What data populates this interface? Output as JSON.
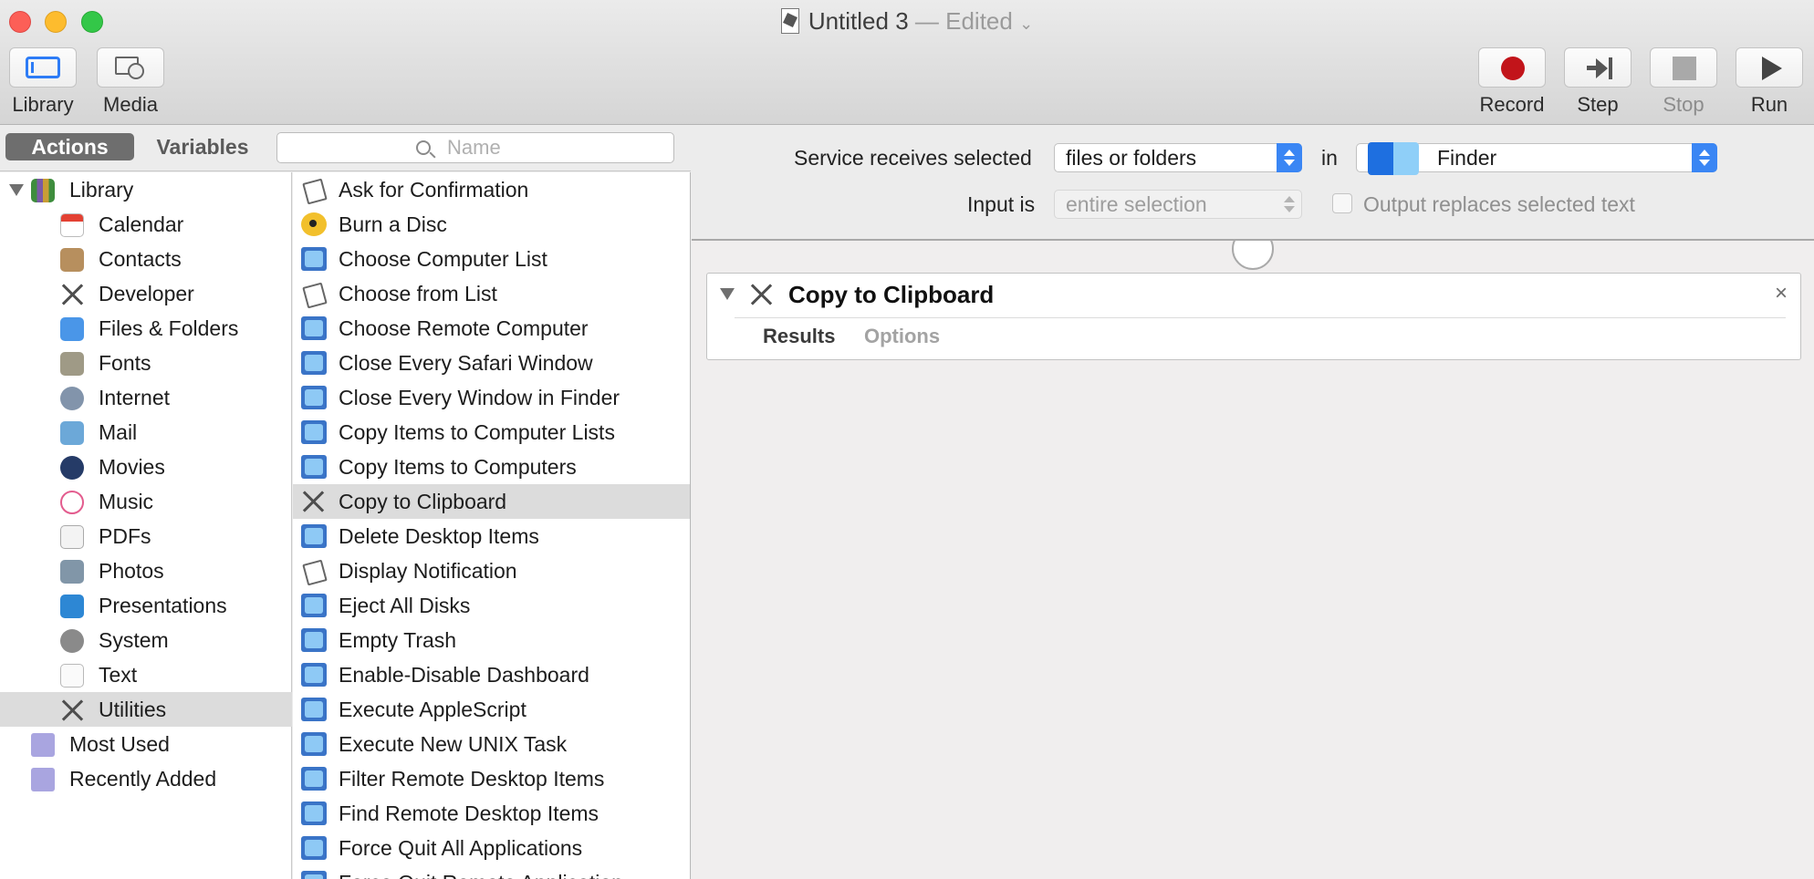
{
  "window": {
    "title": "Untitled 3",
    "title_status": "— Edited"
  },
  "toolbar": {
    "library_label": "Library",
    "media_label": "Media",
    "record_label": "Record",
    "step_label": "Step",
    "stop_label": "Stop",
    "run_label": "Run",
    "record_color": "#c2141a"
  },
  "tabs": {
    "actions": "Actions",
    "variables": "Variables"
  },
  "search": {
    "placeholder": "Name",
    "value": ""
  },
  "library": {
    "root": "Library",
    "items": [
      {
        "label": "Calendar",
        "icon": "calendar-icon"
      },
      {
        "label": "Contacts",
        "icon": "contacts-icon"
      },
      {
        "label": "Developer",
        "icon": "developer-icon"
      },
      {
        "label": "Files & Folders",
        "icon": "finder-icon"
      },
      {
        "label": "Fonts",
        "icon": "fonts-icon"
      },
      {
        "label": "Internet",
        "icon": "internet-icon"
      },
      {
        "label": "Mail",
        "icon": "mail-icon"
      },
      {
        "label": "Movies",
        "icon": "movies-icon"
      },
      {
        "label": "Music",
        "icon": "music-icon"
      },
      {
        "label": "PDFs",
        "icon": "pdf-icon"
      },
      {
        "label": "Photos",
        "icon": "photos-icon"
      },
      {
        "label": "Presentations",
        "icon": "presentations-icon"
      },
      {
        "label": "System",
        "icon": "system-icon"
      },
      {
        "label": "Text",
        "icon": "text-icon"
      },
      {
        "label": "Utilities",
        "icon": "utilities-icon",
        "selected": true
      }
    ],
    "smart_groups": [
      {
        "label": "Most Used",
        "icon": "smart-folder-icon"
      },
      {
        "label": "Recently Added",
        "icon": "smart-folder-icon"
      }
    ]
  },
  "actions": [
    {
      "label": "Ask for Confirmation",
      "icon": "applescript-icon"
    },
    {
      "label": "Burn a Disc",
      "icon": "burn-disc-icon"
    },
    {
      "label": "Choose Computer List",
      "icon": "remote-desktop-icon"
    },
    {
      "label": "Choose from List",
      "icon": "applescript-icon"
    },
    {
      "label": "Choose Remote Computer",
      "icon": "remote-desktop-icon"
    },
    {
      "label": "Close Every Safari Window",
      "icon": "remote-desktop-icon"
    },
    {
      "label": "Close Every Window in Finder",
      "icon": "remote-desktop-icon"
    },
    {
      "label": "Copy Items to Computer Lists",
      "icon": "remote-desktop-icon"
    },
    {
      "label": "Copy Items to Computers",
      "icon": "remote-desktop-icon"
    },
    {
      "label": "Copy to Clipboard",
      "icon": "utilities-icon",
      "selected": true
    },
    {
      "label": "Delete Desktop Items",
      "icon": "remote-desktop-icon"
    },
    {
      "label": "Display Notification",
      "icon": "applescript-icon"
    },
    {
      "label": "Eject All Disks",
      "icon": "remote-desktop-icon"
    },
    {
      "label": "Empty Trash",
      "icon": "remote-desktop-icon"
    },
    {
      "label": "Enable-Disable Dashboard",
      "icon": "remote-desktop-icon"
    },
    {
      "label": "Execute AppleScript",
      "icon": "remote-desktop-icon"
    },
    {
      "label": "Execute New UNIX Task",
      "icon": "remote-desktop-icon"
    },
    {
      "label": "Filter Remote Desktop Items",
      "icon": "remote-desktop-icon"
    },
    {
      "label": "Find Remote Desktop Items",
      "icon": "remote-desktop-icon"
    },
    {
      "label": "Force Quit All Applications",
      "icon": "remote-desktop-icon"
    },
    {
      "label": "Force Quit Remote Application",
      "icon": "remote-desktop-icon"
    }
  ],
  "workflow": {
    "receives_label": "Service receives selected",
    "receives_value": "files or folders",
    "in_label": "in",
    "app_value": "Finder",
    "input_label": "Input is",
    "input_value": "entire selection",
    "output_replaces_label": "Output replaces selected text",
    "output_replaces_checked": false,
    "accent_color": "#3a86f4"
  },
  "action_card": {
    "title": "Copy to Clipboard",
    "close_symbol": "×",
    "tab_results": "Results",
    "tab_options": "Options"
  }
}
